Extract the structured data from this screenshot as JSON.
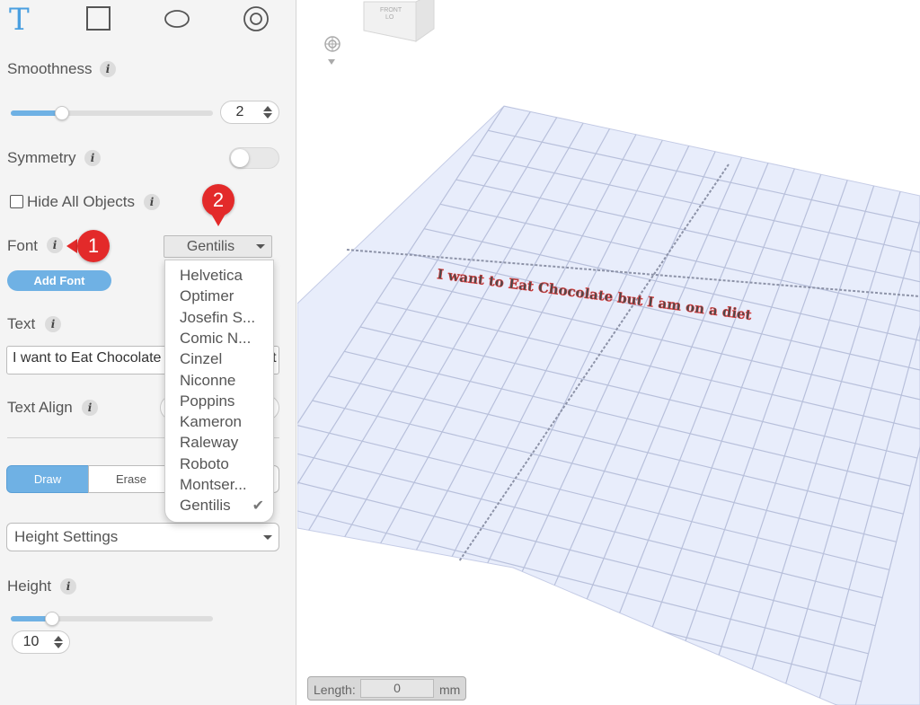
{
  "toolbar": {
    "tools": [
      {
        "name": "text-tool",
        "glyph": "T"
      },
      {
        "name": "rectangle-tool"
      },
      {
        "name": "ellipse-tool"
      },
      {
        "name": "ring-tool"
      }
    ],
    "accent": "#6fb1e4"
  },
  "smoothness": {
    "label": "Smoothness",
    "value": "2",
    "slider_fraction": 0.25
  },
  "symmetry": {
    "label": "Symmetry",
    "on": false
  },
  "hide_all": {
    "label": "Hide All Objects",
    "checked": false
  },
  "font": {
    "label": "Font",
    "selected": "Gentilis",
    "add_font_label": "Add Font",
    "options": [
      "Helvetica",
      "Optimer",
      "Josefin S...",
      "Comic N...",
      "Cinzel",
      "Niconne",
      "Poppins",
      "Kameron",
      "Raleway",
      "Roboto",
      "Montser...",
      "Gentilis"
    ],
    "checkmark": "✔"
  },
  "text": {
    "label": "Text",
    "value": "I want to Eat Chocolate but I am on a diet"
  },
  "text_align": {
    "label": "Text Align"
  },
  "mode": {
    "draw": "Draw",
    "erase": "Erase",
    "active": "Draw"
  },
  "height_settings": {
    "value": "Height Settings"
  },
  "height": {
    "label": "Height",
    "value": "10",
    "slider_fraction": 0.2
  },
  "markers": {
    "one": "1",
    "two": "2"
  },
  "view_cube": {
    "front_label": "FRONT",
    "sub_label": "LO"
  },
  "canvas_text": "I want to Eat Chocolate but I am on a diet",
  "length": {
    "label": "Length:",
    "value": "0",
    "unit": "mm"
  }
}
